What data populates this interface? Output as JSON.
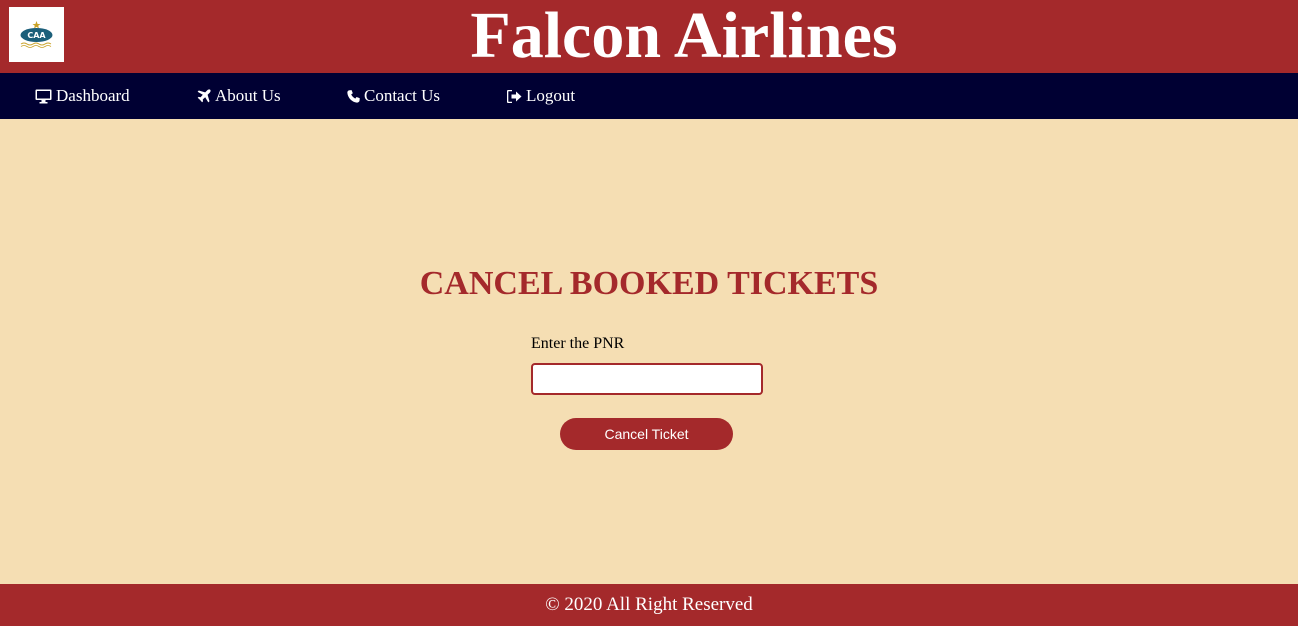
{
  "header": {
    "title": "Falcon Airlines",
    "logo_icon": "caa-logo-icon",
    "logo_text": "CAA"
  },
  "nav": {
    "items": [
      {
        "label": "Dashboard",
        "icon": "monitor-icon"
      },
      {
        "label": "About Us",
        "icon": "plane-icon"
      },
      {
        "label": "Contact Us",
        "icon": "phone-icon"
      },
      {
        "label": "Logout",
        "icon": "logout-icon"
      }
    ]
  },
  "main": {
    "title": "CANCEL BOOKED TICKETS",
    "pnr_label": "Enter the PNR",
    "pnr_value": "",
    "cancel_button_label": "Cancel Ticket"
  },
  "footer": {
    "text": "© 2020 All Right Reserved"
  },
  "colors": {
    "primary": "#a4292b",
    "nav_background": "#000033",
    "page_background": "#f5deb3",
    "text_light": "#ffffff"
  }
}
